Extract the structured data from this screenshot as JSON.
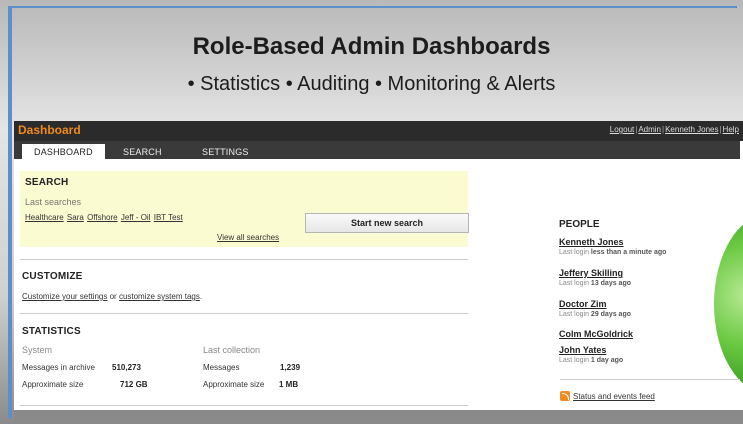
{
  "slide": {
    "title": "Role-Based Admin Dashboards",
    "subtitle": "• Statistics • Auditing • Monitoring & Alerts"
  },
  "header": {
    "brand": "Dashboard",
    "links": [
      "Logout",
      "Admin",
      "Kenneth Jones",
      "Help"
    ]
  },
  "tabs": [
    {
      "label": "DASHBOARD",
      "active": true
    },
    {
      "label": "SEARCH",
      "active": false
    },
    {
      "label": "SETTINGS",
      "active": false
    }
  ],
  "search": {
    "title": "SEARCH",
    "last_label": "Last searches",
    "links": [
      "Healthcare",
      "Sara",
      "Offshore",
      "Jeff - Oil",
      "IBT Test"
    ],
    "view_all": "View all searches",
    "start_button": "Start new search"
  },
  "customize": {
    "title": "CUSTOMIZE",
    "link1": "Customize your settings",
    "connector": " or ",
    "link2": "customize system tags",
    "end": "."
  },
  "statistics": {
    "title": "STATISTICS",
    "system_label": "System",
    "messages_label": "Messages in archive",
    "messages_value": "510,273",
    "size_label": "Approximate size",
    "size_value": "712 GB",
    "last_label": "Last collection",
    "last_messages_label": "Messages",
    "last_messages_value": "1,239",
    "last_size_label": "Approximate size",
    "last_size_value": "1 MB"
  },
  "people": {
    "title": "PEOPLE",
    "items": [
      {
        "name": "Kenneth Jones",
        "login_prefix": "Last login ",
        "login_value": "less than a minute ago"
      },
      {
        "name": "Jeffery Skilling",
        "login_prefix": "Last login ",
        "login_value": "13 days ago"
      },
      {
        "name": "Doctor Zim",
        "login_prefix": "Last login ",
        "login_value": "29 days ago"
      },
      {
        "name": "Colm McGoldrick",
        "login_prefix": "",
        "login_value": ""
      },
      {
        "name": "John Yates",
        "login_prefix": "Last login ",
        "login_value": "1 day ago"
      }
    ],
    "feed": "Status and events feed"
  },
  "colors": {
    "brand": "#f08a1c",
    "topbar": "#2b2b2b",
    "search_bg": "#fbfbd2",
    "frame": "#5b8fc8"
  }
}
